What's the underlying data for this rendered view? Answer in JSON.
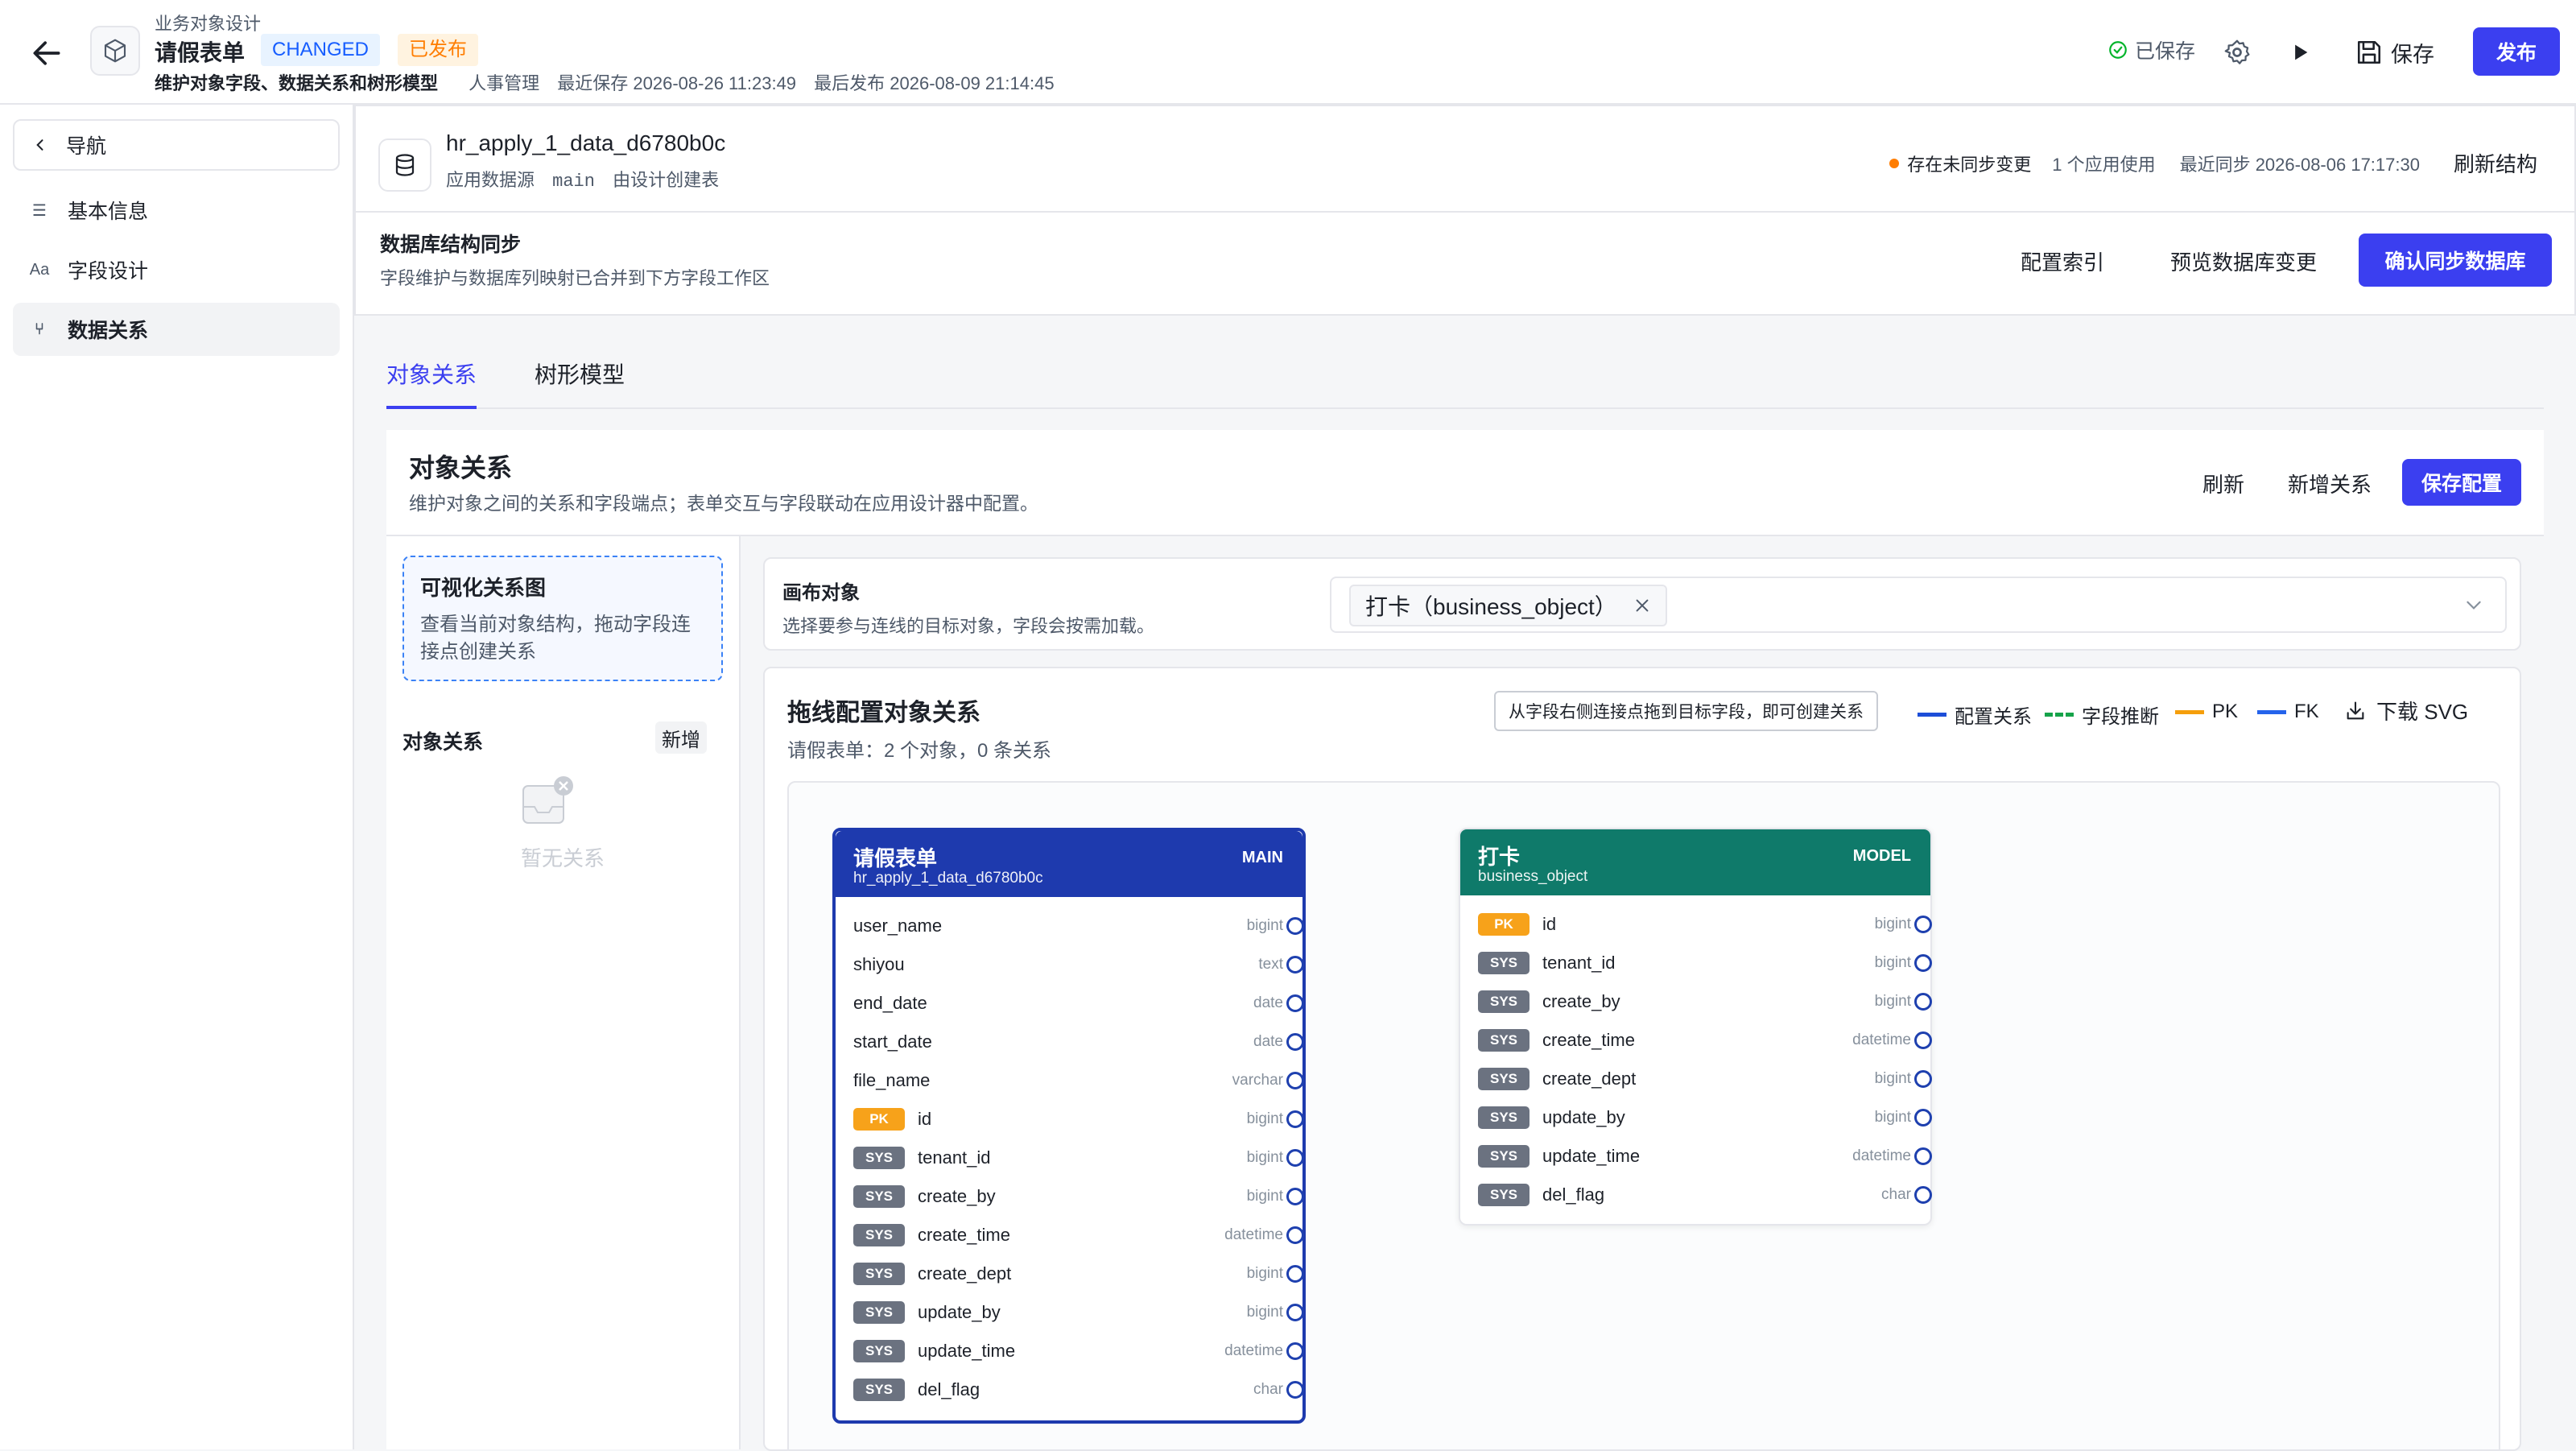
{
  "header": {
    "breadcrumb": "业务对象设计",
    "title": "请假表单",
    "badge_changed": "CHANGED",
    "badge_published": "已发布",
    "subtitle": "维护对象字段、数据关系和树形模型",
    "category": "人事管理",
    "last_saved": "最近保存 2026-08-26 11:23:49",
    "last_published": "最后发布 2026-08-09 21:14:45",
    "saved_status": "已保存",
    "save_label": "保存",
    "publish_label": "发布"
  },
  "sidebar": {
    "nav_label": "导航",
    "items": [
      {
        "icon": "sliders-icon",
        "glyph": "☰",
        "label": "基本信息"
      },
      {
        "icon": "text-icon",
        "glyph": "Aa",
        "label": "字段设计"
      },
      {
        "icon": "branch-icon",
        "glyph": "⑂",
        "label": "数据关系"
      }
    ]
  },
  "datasource": {
    "table": "hr_apply_1_data_d6780b0c",
    "source_label": "应用数据源",
    "schema": "main",
    "created_by": "由设计创建表",
    "pending": "存在未同步变更",
    "usage": "1 个应用使用",
    "last_sync": "最近同步 2026-08-06 17:17:30",
    "refresh": "刷新结构",
    "sync_title": "数据库结构同步",
    "sync_sub": "字段维护与数据库列映射已合并到下方字段工作区",
    "config_index": "配置索引",
    "preview_change": "预览数据库变更",
    "confirm_sync": "确认同步数据库"
  },
  "tabs": [
    "对象关系",
    "树形模型"
  ],
  "relations": {
    "title": "对象关系",
    "subtitle": "维护对象之间的关系和字段端点；表单交互与字段联动在应用设计器中配置。",
    "refresh": "刷新",
    "add": "新增关系",
    "save": "保存配置",
    "viz_title": "可视化关系图",
    "viz_desc": "查看当前对象结构，拖动字段连接点创建关系",
    "list_title": "对象关系",
    "list_add": "新增",
    "empty": "暂无关系"
  },
  "canvas": {
    "label": "画布对象",
    "desc": "选择要参与连线的目标对象，字段会按需加载。",
    "selected": "打卡（business_object）",
    "drag_title": "拖线配置对象关系",
    "summary": "请假表单：2 个对象，0 条关系",
    "hint": "从字段右侧连接点拖到目标字段，即可创建关系",
    "legend": {
      "config": "配置关系",
      "infer": "字段推断",
      "pk": "PK",
      "fk": "FK"
    },
    "download": "下载 SVG"
  },
  "entities": [
    {
      "name": "请假表单",
      "table": "hr_apply_1_data_d6780b0c",
      "tag": "MAIN",
      "color": "#1e3aae",
      "fields": [
        {
          "name": "user_name",
          "type": "bigint",
          "badge": ""
        },
        {
          "name": "shiyou",
          "type": "text",
          "badge": ""
        },
        {
          "name": "end_date",
          "type": "date",
          "badge": ""
        },
        {
          "name": "start_date",
          "type": "date",
          "badge": ""
        },
        {
          "name": "file_name",
          "type": "varchar",
          "badge": ""
        },
        {
          "name": "id",
          "type": "bigint",
          "badge": "PK"
        },
        {
          "name": "tenant_id",
          "type": "bigint",
          "badge": "SYS"
        },
        {
          "name": "create_by",
          "type": "bigint",
          "badge": "SYS"
        },
        {
          "name": "create_time",
          "type": "datetime",
          "badge": "SYS"
        },
        {
          "name": "create_dept",
          "type": "bigint",
          "badge": "SYS"
        },
        {
          "name": "update_by",
          "type": "bigint",
          "badge": "SYS"
        },
        {
          "name": "update_time",
          "type": "datetime",
          "badge": "SYS"
        },
        {
          "name": "del_flag",
          "type": "char",
          "badge": "SYS"
        }
      ]
    },
    {
      "name": "打卡",
      "table": "business_object",
      "tag": "MODEL",
      "color": "#0f7a6a",
      "fields": [
        {
          "name": "id",
          "type": "bigint",
          "badge": "PK"
        },
        {
          "name": "tenant_id",
          "type": "bigint",
          "badge": "SYS"
        },
        {
          "name": "create_by",
          "type": "bigint",
          "badge": "SYS"
        },
        {
          "name": "create_time",
          "type": "datetime",
          "badge": "SYS"
        },
        {
          "name": "create_dept",
          "type": "bigint",
          "badge": "SYS"
        },
        {
          "name": "update_by",
          "type": "bigint",
          "badge": "SYS"
        },
        {
          "name": "update_time",
          "type": "datetime",
          "badge": "SYS"
        },
        {
          "name": "del_flag",
          "type": "char",
          "badge": "SYS"
        }
      ]
    }
  ],
  "colors": {
    "primary": "#3b3ff0",
    "pk": "#f7a21a",
    "sys": "#6b7280",
    "legend_config": "#1d4ed8",
    "legend_infer": "#16a34a",
    "legend_pk": "#f59e0b",
    "legend_fk": "#2563eb"
  }
}
